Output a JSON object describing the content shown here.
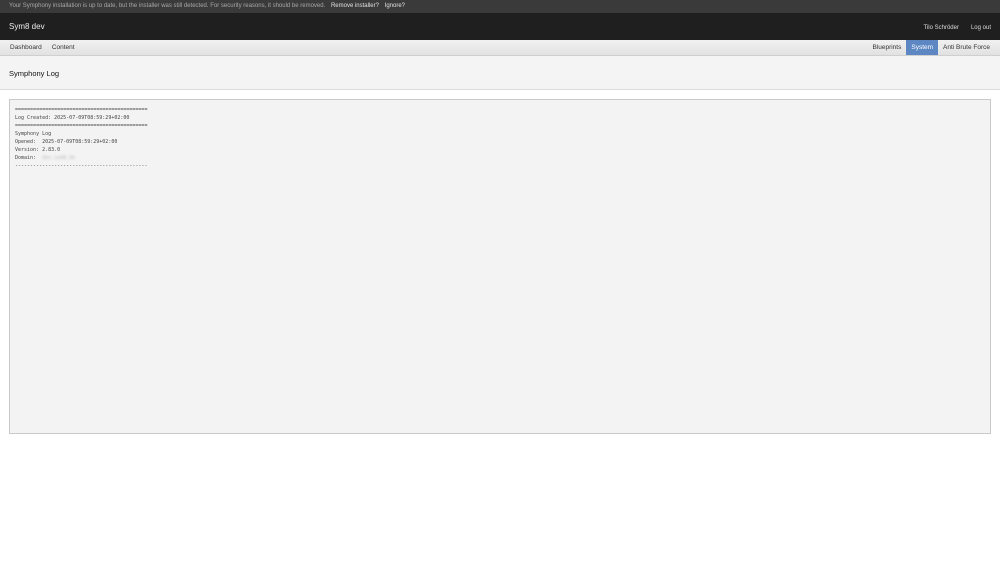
{
  "notice": {
    "message": "Your Symphony installation is up to date, but the installer was still detected. For security reasons, it should be removed.",
    "remove_label": "Remove installer?",
    "ignore_label": "Ignore?"
  },
  "header": {
    "title": "Sym8 dev",
    "user": "Tilo Schröder",
    "logout_label": "Log out"
  },
  "nav": {
    "left": [
      {
        "label": "Dashboard"
      },
      {
        "label": "Content"
      }
    ],
    "right": [
      {
        "label": "Blueprints"
      },
      {
        "label": "System",
        "active": true
      },
      {
        "label": "Anti Brute Force"
      }
    ]
  },
  "page": {
    "title": "Symphony Log"
  },
  "log": {
    "separator_eq": "============================================",
    "created": "Log Created: 2025-07-09T08:59:29+02:00",
    "name": "Symphony Log",
    "opened": "Opened:  2025-07-09T08:59:29+02:00",
    "version": "Version: 2.83.0",
    "domain_label": "Domain:  ",
    "domain_value": "dev.sym8.de",
    "separator_dash": "--------------------------------------------"
  },
  "colors": {
    "active_tab": "#5d87c3",
    "header_bg": "#1f1f1f",
    "notice_bg": "#3a3a3a"
  }
}
